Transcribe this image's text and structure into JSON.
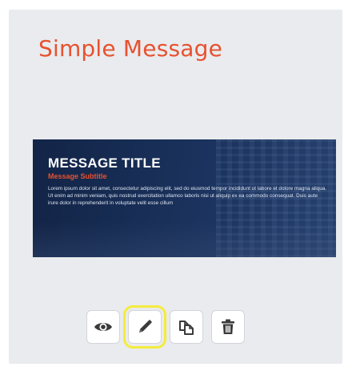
{
  "card": {
    "title": "Simple Message"
  },
  "preview": {
    "message_title": "MESSAGE TITLE",
    "message_subtitle": "Message Subtitle",
    "message_body": "Lorem ipsum dolor sit amet, consectetur adipiscing elit, sed do eiusmod tempor incididunt ut labore et dolore magna aliqua. Ut enim ad minim veniam, quis nostrud exercitation ullamco laboris nisi ut aliquip ex ea commodo consequat. Duis aute irure dolor in reprehenderit in voluptate velit esse cillum"
  },
  "toolbar": {
    "buttons": [
      {
        "icon": "eye-icon",
        "action": "preview",
        "active": false
      },
      {
        "icon": "pencil-icon",
        "action": "edit",
        "active": true
      },
      {
        "icon": "duplicate-icon",
        "action": "duplicate",
        "active": false
      },
      {
        "icon": "trash-icon",
        "action": "delete",
        "active": false
      }
    ]
  },
  "colors": {
    "title_accent": "#e8512f",
    "card_background": "#e9ebee",
    "highlight": "#f4ec3d",
    "preview_background": "#1c355f"
  }
}
